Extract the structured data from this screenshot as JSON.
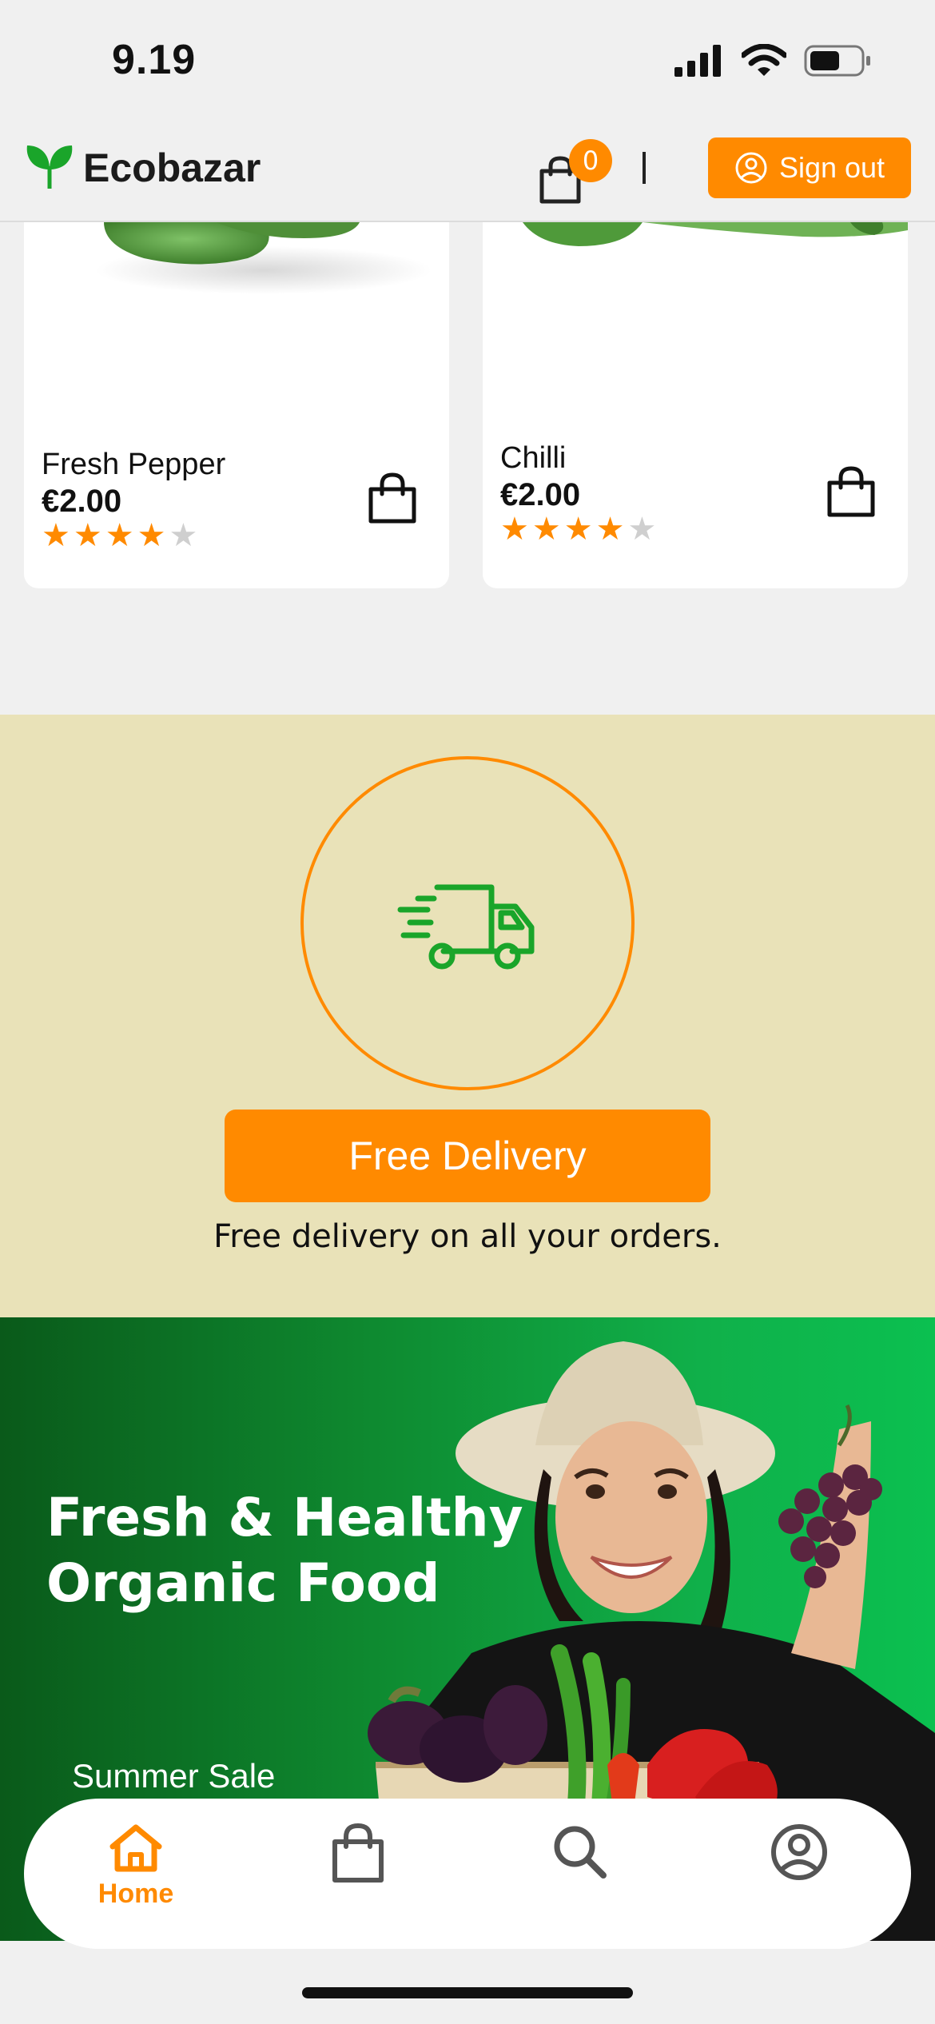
{
  "status_bar": {
    "time": "9.19"
  },
  "header": {
    "brand": "Ecobazar",
    "cart_count": "0",
    "signout_label": "Sign out"
  },
  "products": [
    {
      "name": "Fresh Pepper",
      "price": "€2.00",
      "rating": 4,
      "max_rating": 5
    },
    {
      "name": "Chilli",
      "price": "€2.00",
      "rating": 4,
      "max_rating": 5
    }
  ],
  "delivery": {
    "button_label": "Free Delivery",
    "description": "Free delivery on all your orders."
  },
  "hero": {
    "title_line1": "Fresh & Healthy",
    "title_line2": "Organic Food",
    "subtitle": "Summer Sale"
  },
  "tabbar": {
    "home_label": "Home"
  },
  "colors": {
    "accent": "#ff8a00",
    "brand_green": "#1aa52a",
    "delivery_bg": "#e9e2b8"
  }
}
